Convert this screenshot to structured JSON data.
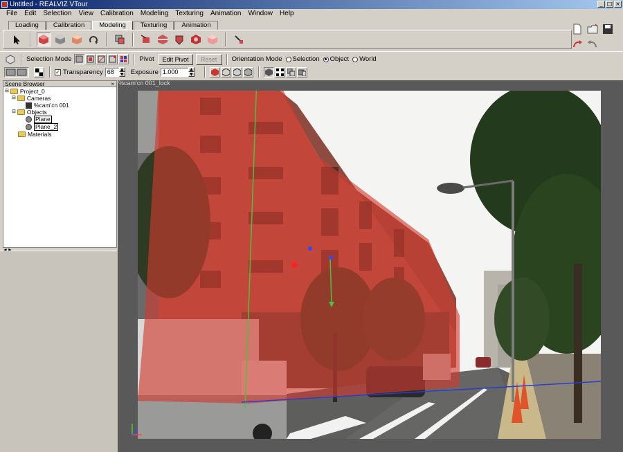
{
  "window": {
    "title": "Untitled - REALVIZ VTour",
    "btn_min": "_",
    "btn_max": "□",
    "btn_close": "×"
  },
  "menu": [
    "File",
    "Edit",
    "Selection",
    "View",
    "Calibration",
    "Modeling",
    "Texturing",
    "Animation",
    "Window",
    "Help"
  ],
  "tabs": [
    "Loading",
    "Calibration",
    "Modeling",
    "Texturing",
    "Animation"
  ],
  "active_tab": "Modeling",
  "modeling_tools": [
    "arrow-select-tool",
    "cube-red-tool",
    "cube-gray-tool",
    "cube-orange-tool",
    "rotate-tool",
    "multi-object-tool",
    "move-tool",
    "split-tool",
    "extrude-tool",
    "shield-tool",
    "box-tool",
    "wand-tool"
  ],
  "bar2": {
    "selection_mode_label": "Selection Mode",
    "pivot_label": "Pivot",
    "edit_pivot": "Edit Pivot",
    "reset": "Reset",
    "orientation_label": "Orientation Mode",
    "orientation_options": [
      "Selection",
      "Object",
      "World"
    ],
    "orientation_selected": "Object"
  },
  "bar3": {
    "transparency_label": "Transparency",
    "transparency_checked": true,
    "transparency_value": "68",
    "exposure_label": "Exposure",
    "exposure_value": "1.000",
    "spin_up": "▲",
    "spin_down": "▼"
  },
  "scene_browser": {
    "title": "Scene Browser",
    "close": "×",
    "project": "Project_0",
    "cameras": "Cameras",
    "camera_item": "%cam'cn 001",
    "objects": "Objects",
    "object_items": [
      "Plane",
      "Plane_2"
    ],
    "materials": "Materials"
  },
  "splitter_label": "◄►",
  "viewport": {
    "label": "%cam'cn 001_lock",
    "overlay_color": "#d23a2e",
    "overlay_opacity": 0.68
  }
}
